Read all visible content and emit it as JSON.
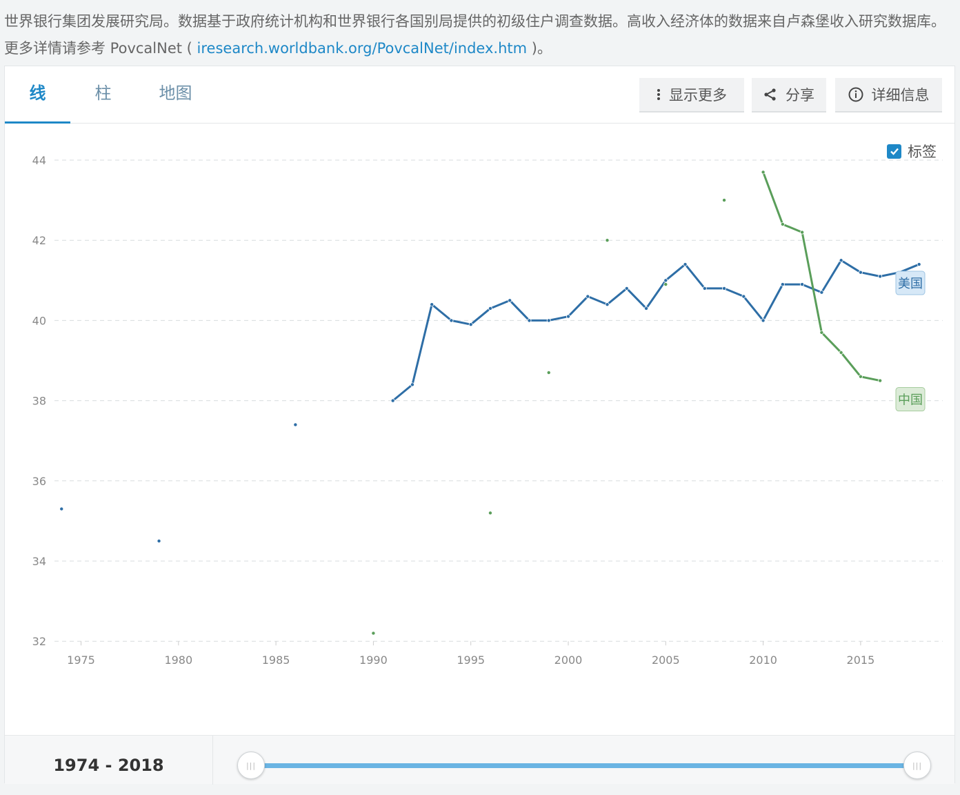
{
  "source": {
    "text": "世界银行集团发展研究局。数据基于政府统计机构和世界银行各国别局提供的初级住户调查数据。高收入经济体的数据来自卢森堡收入研究数据库。更多详情请参考 PovcalNet ( ",
    "link": "iresearch.worldbank.org/PovcalNet/index.htm",
    "suffix": " )。"
  },
  "tabs": [
    {
      "label": "线"
    },
    {
      "label": "柱"
    },
    {
      "label": "地图"
    }
  ],
  "buttons": {
    "more": "显示更多",
    "share": "分享",
    "details": "详细信息"
  },
  "labels_toggle": "标签",
  "footer": {
    "range": "1974 - 2018"
  },
  "colors": {
    "accent": "#1e88c7",
    "usa": "#2e6ea6",
    "china": "#5a9e5a"
  },
  "chart_data": {
    "type": "line",
    "xlim": [
      1973,
      2018.5
    ],
    "ylim": [
      32,
      44
    ],
    "yticks": [
      32,
      34,
      36,
      38,
      40,
      42,
      44
    ],
    "xticks": [
      1975,
      1980,
      1985,
      1990,
      1995,
      2000,
      2005,
      2010,
      2015
    ],
    "grid": true,
    "series": [
      {
        "name": "美国",
        "color": "#2e6ea6",
        "points": [
          [
            1974,
            35.3
          ],
          [
            1979,
            34.5
          ],
          [
            1986,
            37.4
          ],
          [
            1991,
            38.0
          ],
          [
            1992,
            38.4
          ],
          [
            1993,
            40.4
          ],
          [
            1994,
            40.0
          ],
          [
            1995,
            39.9
          ],
          [
            1996,
            40.3
          ],
          [
            1997,
            40.5
          ],
          [
            1998,
            40.0
          ],
          [
            1999,
            40.0
          ],
          [
            2000,
            40.1
          ],
          [
            2001,
            40.6
          ],
          [
            2002,
            40.4
          ],
          [
            2003,
            40.8
          ],
          [
            2004,
            40.3
          ],
          [
            2005,
            41.0
          ],
          [
            2006,
            41.4
          ],
          [
            2007,
            40.8
          ],
          [
            2008,
            40.8
          ],
          [
            2009,
            40.6
          ],
          [
            2010,
            40.0
          ],
          [
            2011,
            40.9
          ],
          [
            2012,
            40.9
          ],
          [
            2013,
            40.7
          ],
          [
            2014,
            41.5
          ],
          [
            2015,
            41.2
          ],
          [
            2016,
            41.1
          ],
          [
            2017,
            41.2
          ],
          [
            2018,
            41.4
          ]
        ]
      },
      {
        "name": "中国",
        "color": "#5a9e5a",
        "points": [
          [
            1990,
            32.2
          ],
          [
            1996,
            35.2
          ],
          [
            1999,
            38.7
          ],
          [
            2002,
            42.0
          ],
          [
            2005,
            40.9
          ],
          [
            2008,
            43.0
          ],
          [
            2010,
            43.7
          ],
          [
            2011,
            42.4
          ],
          [
            2012,
            42.2
          ],
          [
            2013,
            39.7
          ],
          [
            2014,
            39.2
          ],
          [
            2015,
            38.6
          ],
          [
            2016,
            38.5
          ]
        ]
      }
    ]
  }
}
